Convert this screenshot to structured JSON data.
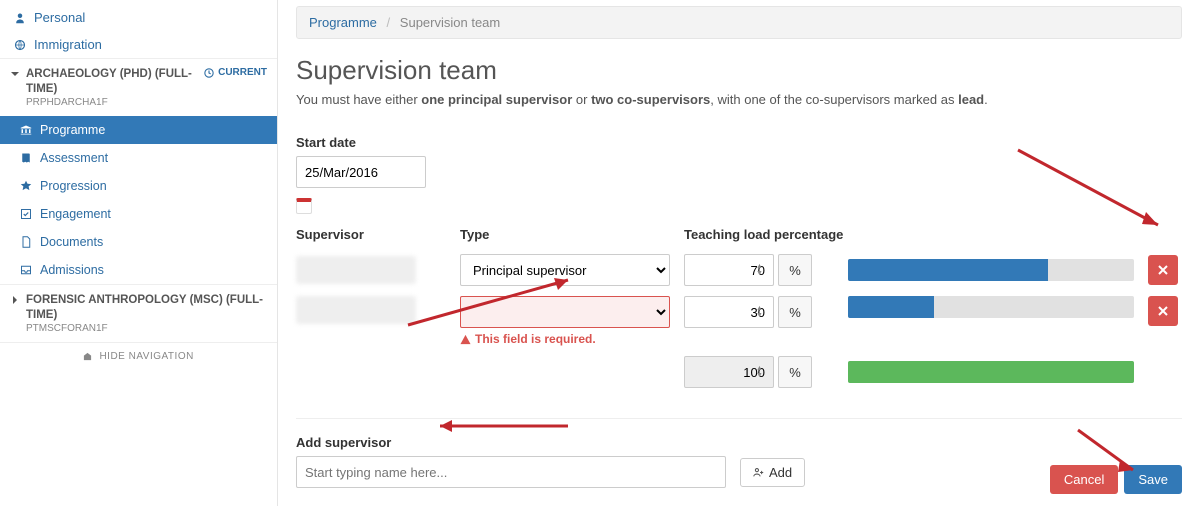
{
  "sidebar": {
    "top": [
      {
        "icon": "user",
        "label": "Personal"
      },
      {
        "icon": "globe",
        "label": "Immigration"
      }
    ],
    "prog1": {
      "title": "ARCHAEOLOGY (PHD) (FULL-TIME)",
      "code": "PRPHDARCHA1F",
      "badge": "CURRENT",
      "items": [
        {
          "icon": "bank",
          "label": "Programme",
          "active": true
        },
        {
          "icon": "book",
          "label": "Assessment"
        },
        {
          "icon": "star",
          "label": "Progression"
        },
        {
          "icon": "check",
          "label": "Engagement"
        },
        {
          "icon": "file",
          "label": "Documents"
        },
        {
          "icon": "inbox",
          "label": "Admissions"
        }
      ]
    },
    "prog2": {
      "title": "FORENSIC ANTHROPOLOGY (MSC) (FULL-TIME)",
      "code": "PTMSCFORAN1F"
    },
    "hide": "HIDE NAVIGATION"
  },
  "breadcrumb": {
    "parent": "Programme",
    "current": "Supervision team"
  },
  "page": {
    "title": "Supervision team",
    "subtitle_prefix": "You must have either ",
    "subtitle_b1": "one principal supervisor",
    "subtitle_mid": " or ",
    "subtitle_b2": "two co-supervisors",
    "subtitle_suffix_a": ", with one of the co-supervisors marked as ",
    "subtitle_b3": "lead",
    "subtitle_end": "."
  },
  "start_date": {
    "label": "Start date",
    "value": "25/Mar/2016"
  },
  "columns": {
    "supervisor": "Supervisor",
    "type": "Type",
    "load": "Teaching load percentage"
  },
  "rows": [
    {
      "type": "Principal supervisor",
      "load": "70",
      "bar": 70,
      "error": false
    },
    {
      "type": "",
      "load": "30",
      "bar": 30,
      "error": true
    }
  ],
  "error_text": "This field is required.",
  "total": {
    "load": "100",
    "bar": 100
  },
  "pct": "%",
  "add": {
    "label": "Add supervisor",
    "placeholder": "Start typing name here...",
    "button": "Add"
  },
  "buttons": {
    "cancel": "Cancel",
    "save": "Save"
  }
}
